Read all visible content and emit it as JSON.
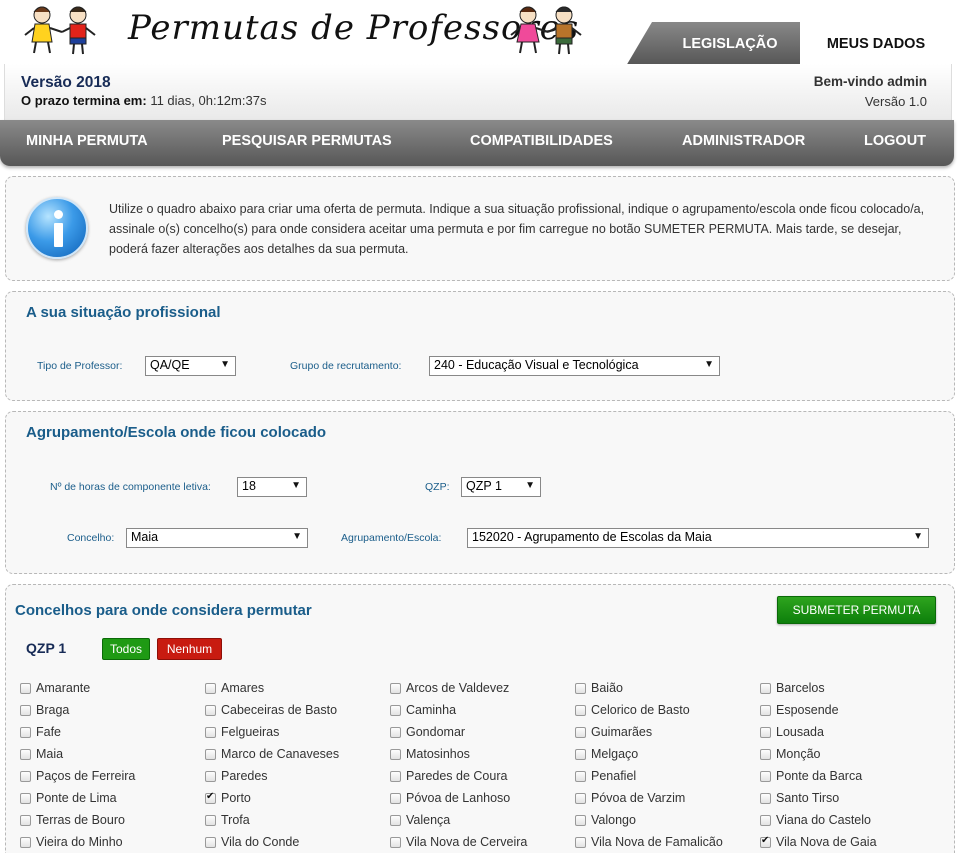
{
  "header": {
    "site_title": "Permutas de Professores",
    "tabs": [
      {
        "label": "LEGISLAÇÃO"
      },
      {
        "label": "MEUS DADOS"
      }
    ]
  },
  "status": {
    "version_title": "Versão 2018",
    "deadline_label": "O prazo termina em:",
    "deadline_value": "11 dias, 0h:12m:37s",
    "welcome": "Bem-vindo admin",
    "app_version": "Versão 1.0"
  },
  "nav": {
    "items": [
      {
        "label": "MINHA PERMUTA"
      },
      {
        "label": "PESQUISAR PERMUTAS"
      },
      {
        "label": "COMPATIBILIDADES"
      },
      {
        "label": "ADMINISTRADOR"
      },
      {
        "label": "LOGOUT"
      }
    ]
  },
  "info": {
    "text": "Utilize o quadro abaixo para criar uma oferta de permuta. Indique a sua situação profissional, indique o agrupamento/escola onde ficou colocado/a, assinale o(s) concelho(s) para onde considera aceitar uma permuta e por fim carregue no botão SUMETER PERMUTA. Mais tarde, se desejar, poderá fazer alterações aos detalhes da sua permuta."
  },
  "situacao": {
    "title": "A sua situação profissional",
    "tipo_label": "Tipo de Professor:",
    "tipo_value": "QA/QE",
    "grupo_label": "Grupo de recrutamento:",
    "grupo_value": "240 - Educação Visual e Tecnológica"
  },
  "agrupamento": {
    "title": "Agrupamento/Escola onde ficou colocado",
    "horas_label": "Nº de horas de componente letiva:",
    "horas_value": "18",
    "qzp_label": "QZP:",
    "qzp_value": "QZP 1",
    "concelho_label": "Concelho:",
    "concelho_value": "Maia",
    "escola_label": "Agrupamento/Escola:",
    "escola_value": "152020 - Agrupamento de Escolas da Maia"
  },
  "concelhos": {
    "title": "Concelhos para onde considera permutar",
    "submit_label": "SUBMETER PERMUTA",
    "qzp_heading": "QZP 1",
    "all_label": "Todos",
    "none_label": "Nenhum",
    "items": [
      {
        "label": "Amarante",
        "checked": false
      },
      {
        "label": "Amares",
        "checked": false
      },
      {
        "label": "Arcos de Valdevez",
        "checked": false
      },
      {
        "label": "Baião",
        "checked": false
      },
      {
        "label": "Barcelos",
        "checked": false
      },
      {
        "label": "Braga",
        "checked": false
      },
      {
        "label": "Cabeceiras de Basto",
        "checked": false
      },
      {
        "label": "Caminha",
        "checked": false
      },
      {
        "label": "Celorico de Basto",
        "checked": false
      },
      {
        "label": "Esposende",
        "checked": false
      },
      {
        "label": "Fafe",
        "checked": false
      },
      {
        "label": "Felgueiras",
        "checked": false
      },
      {
        "label": "Gondomar",
        "checked": false
      },
      {
        "label": "Guimarães",
        "checked": false
      },
      {
        "label": "Lousada",
        "checked": false
      },
      {
        "label": "Maia",
        "checked": false
      },
      {
        "label": "Marco de Canaveses",
        "checked": false
      },
      {
        "label": "Matosinhos",
        "checked": false
      },
      {
        "label": "Melgaço",
        "checked": false
      },
      {
        "label": "Monção",
        "checked": false
      },
      {
        "label": "Paços de Ferreira",
        "checked": false
      },
      {
        "label": "Paredes",
        "checked": false
      },
      {
        "label": "Paredes de Coura",
        "checked": false
      },
      {
        "label": "Penafiel",
        "checked": false
      },
      {
        "label": "Ponte da Barca",
        "checked": false
      },
      {
        "label": "Ponte de Lima",
        "checked": false
      },
      {
        "label": "Porto",
        "checked": true
      },
      {
        "label": "Póvoa de Lanhoso",
        "checked": false
      },
      {
        "label": "Póvoa de Varzim",
        "checked": false
      },
      {
        "label": "Santo Tirso",
        "checked": false
      },
      {
        "label": "Terras de Bouro",
        "checked": false
      },
      {
        "label": "Trofa",
        "checked": false
      },
      {
        "label": "Valença",
        "checked": false
      },
      {
        "label": "Valongo",
        "checked": false
      },
      {
        "label": "Viana do Castelo",
        "checked": false
      },
      {
        "label": "Vieira do Minho",
        "checked": false
      },
      {
        "label": "Vila do Conde",
        "checked": false
      },
      {
        "label": "Vila Nova de Cerveira",
        "checked": false
      },
      {
        "label": "Vila Nova de Famalicão",
        "checked": false
      },
      {
        "label": "Vila Nova de Gaia",
        "checked": true
      }
    ]
  }
}
